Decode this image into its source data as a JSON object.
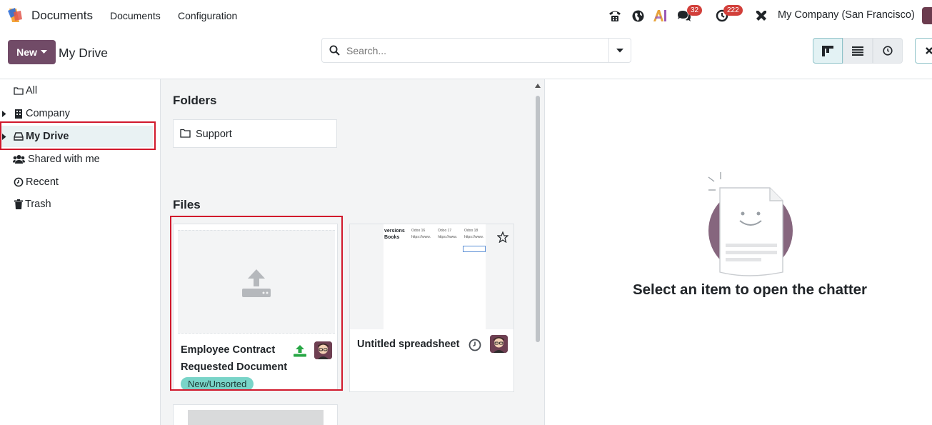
{
  "topbar": {
    "app_title": "Documents",
    "menu": [
      "Documents",
      "Configuration"
    ],
    "badges": {
      "messages": "32",
      "activities": "222"
    },
    "company": "My Company (San Francisco)"
  },
  "controlbar": {
    "new_label": "New",
    "breadcrumb": "My Drive",
    "search_placeholder": "Search..."
  },
  "sidebar": {
    "items": [
      {
        "label": "All",
        "icon": "folder-icon"
      },
      {
        "label": "Company",
        "icon": "building-icon"
      },
      {
        "label": "My Drive",
        "icon": "drive-icon"
      },
      {
        "label": "Shared with me",
        "icon": "users-icon"
      },
      {
        "label": "Recent",
        "icon": "clock-icon"
      },
      {
        "label": "Trash",
        "icon": "trash-icon"
      }
    ],
    "selected": "My Drive"
  },
  "main": {
    "folders_title": "Folders",
    "folders": [
      {
        "name": "Support"
      }
    ],
    "files_title": "Files",
    "files": [
      {
        "name_line1": "Employee Contract",
        "name_line2": "Requested Document",
        "tag": "New/Unsorted",
        "status_icon": "upload-icon"
      },
      {
        "name": "Untitled spreadsheet",
        "status_icon": "clock-icon",
        "thumb_header": [
          "versions",
          "Books"
        ],
        "thumb_cols": [
          "Odoo 16",
          "Odoo 17",
          "Odoo 18"
        ],
        "thumb_cell": "https://www."
      }
    ]
  },
  "chatter": {
    "empty_message": "Select an item to open the chatter"
  },
  "colors": {
    "brand": "#714b67",
    "accent_tag": "#79d4c8",
    "highlight_red": "#d1192c",
    "badge_red": "#d23f3a"
  }
}
